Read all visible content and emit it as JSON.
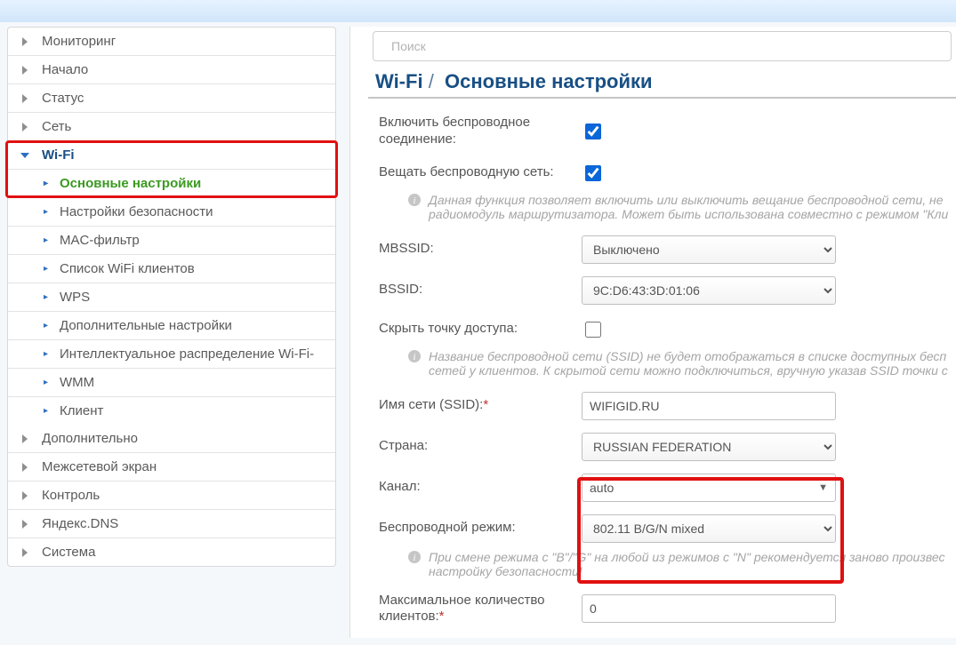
{
  "search": {
    "placeholder": "Поиск"
  },
  "breadcrumb": {
    "section": "Wi-Fi",
    "sep": "/",
    "page": "Основные настройки"
  },
  "sidebar": {
    "top": [
      {
        "label": "Мониторинг"
      },
      {
        "label": "Начало"
      },
      {
        "label": "Статус"
      },
      {
        "label": "Сеть"
      }
    ],
    "wifi": {
      "label": "Wi-Fi",
      "children": [
        {
          "label": "Основные настройки",
          "active": true
        },
        {
          "label": "Настройки безопасности"
        },
        {
          "label": "MAC-фильтр"
        },
        {
          "label": "Список WiFi клиентов"
        },
        {
          "label": "WPS"
        },
        {
          "label": "Дополнительные настройки"
        },
        {
          "label": "Интеллектуальное распределение Wi-Fi-"
        },
        {
          "label": "WMM"
        },
        {
          "label": "Клиент"
        }
      ]
    },
    "bottom": [
      {
        "label": "Дополнительно"
      },
      {
        "label": "Межсетевой экран"
      },
      {
        "label": "Контроль"
      },
      {
        "label": "Яндекс.DNS"
      },
      {
        "label": "Система"
      }
    ]
  },
  "form": {
    "enable_label": "Включить беспроводное соединение:",
    "broadcast_label": "Вещать беспроводную сеть:",
    "broadcast_hint": "Данная функция позволяет включить или выключить вещание беспроводной сети, не радиомодуль маршрутизатора. Может быть использована совместно с режимом \"Кли",
    "mbssid_label": "MBSSID:",
    "mbssid_value": "Выключено",
    "bssid_label": "BSSID:",
    "bssid_value": "9C:D6:43:3D:01:06",
    "hide_label": "Скрыть точку доступа:",
    "hide_hint": "Название беспроводной сети (SSID) не будет отображаться в списке доступных бесп сетей у клиентов. К скрытой сети можно подключиться, вручную указав SSID точки с",
    "ssid_label": "Имя сети (SSID):",
    "ssid_value": "WIFIGID.RU",
    "country_label": "Страна:",
    "country_value": "RUSSIAN FEDERATION",
    "channel_label": "Канал:",
    "channel_value": "auto",
    "mode_label": "Беспроводной режим:",
    "mode_value": "802.11 B/G/N mixed",
    "mode_hint": "При смене режима с \"B\"/\"G\" на любой из режимов с \"N\" рекомендуется заново произвес настройку безопасности!",
    "max_label": "Максимальное количество клиентов:",
    "max_value": "0",
    "req": "*"
  }
}
